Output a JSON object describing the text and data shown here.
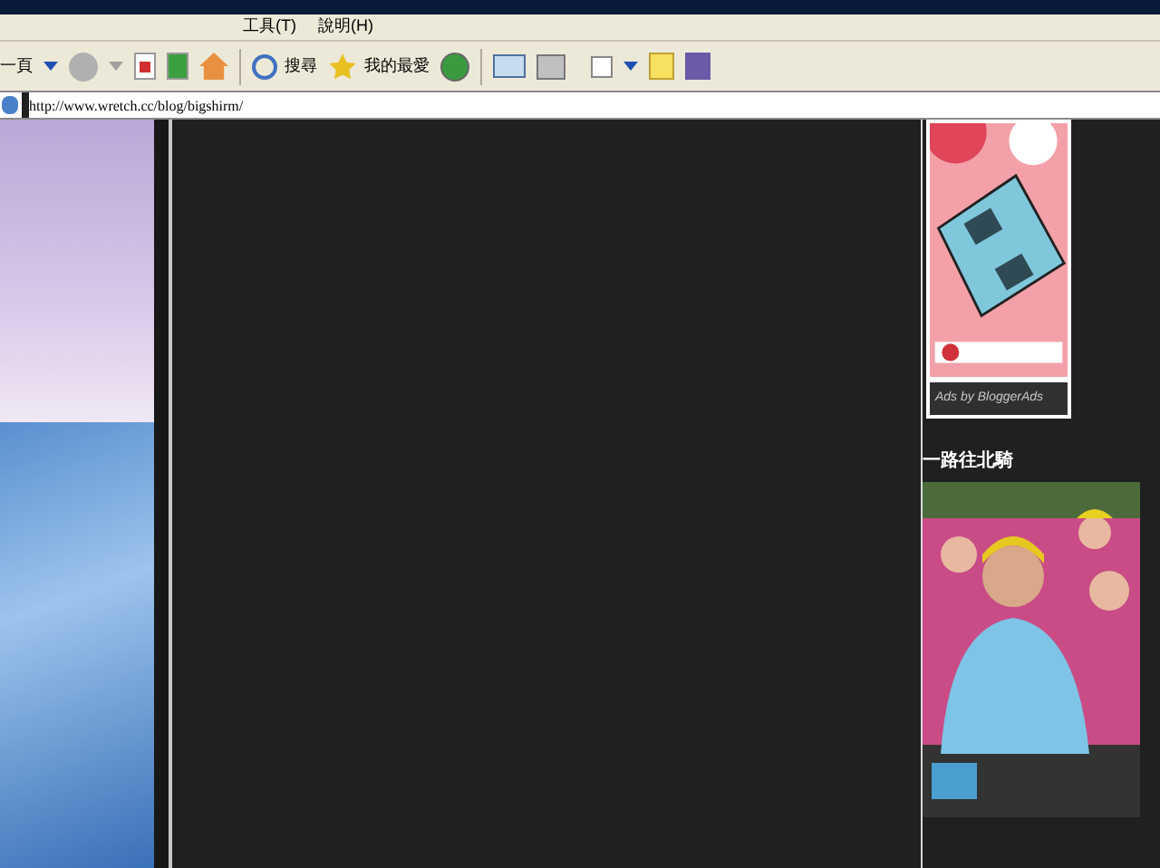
{
  "menu": [
    {
      "label": "工具(T)"
    },
    {
      "label": "說明(H)"
    }
  ],
  "toolbar": {
    "back_label": "一頁",
    "search_label": "搜尋",
    "favorites_label": "我的最愛"
  },
  "address": {
    "value": "http://www.wretch.cc/blog/bigshirm/"
  },
  "sidebar": {
    "ad": {
      "kind": "picture",
      "credit": "Ads by BloggerAds"
    },
    "section": {
      "title": "一路往北騎"
    }
  }
}
